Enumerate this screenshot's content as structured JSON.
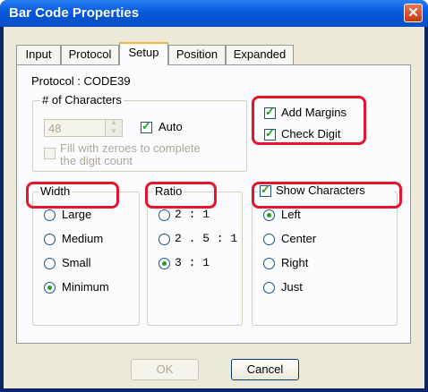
{
  "window": {
    "title": "Bar Code Properties",
    "close_glyph": "✕"
  },
  "tabs": [
    {
      "label": "Input"
    },
    {
      "label": "Protocol"
    },
    {
      "label": "Setup"
    },
    {
      "label": "Position"
    },
    {
      "label": "Expanded"
    }
  ],
  "active_tab": "Setup",
  "protocol_label": "Protocol : CODE39",
  "characters": {
    "group_label": "# of Characters",
    "count_value": "48",
    "auto_label": "Auto",
    "auto_checked": true,
    "fill_zeroes_label_line1": "Fill with zeroes to complete",
    "fill_zeroes_label_line2": "the digit count",
    "fill_zeroes_checked": false
  },
  "options": {
    "add_margins_label": "Add Margins",
    "add_margins_checked": true,
    "check_digit_label": "Check Digit",
    "check_digit_checked": true
  },
  "width": {
    "group_label": "Width",
    "options": [
      "Large",
      "Medium",
      "Small",
      "Minimum"
    ],
    "selected": "Minimum"
  },
  "ratio": {
    "group_label": "Ratio",
    "options": [
      "2 : 1",
      "2 . 5 : 1",
      "3 : 1"
    ],
    "selected": "3 : 1"
  },
  "show_characters": {
    "group_label": "Show Characters",
    "checked": true,
    "options": [
      "Left",
      "Center",
      "Right",
      "Just"
    ],
    "selected": "Left"
  },
  "buttons": {
    "ok_label": "OK",
    "cancel_label": "Cancel"
  },
  "colors": {
    "highlight": "#e3162e",
    "accent": "#21a121",
    "titlebar": "#0a5ddd"
  }
}
